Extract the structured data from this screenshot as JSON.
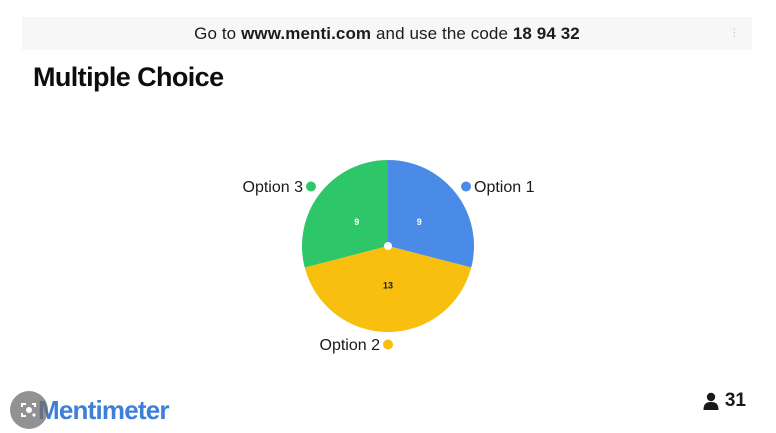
{
  "banner": {
    "prefix": "Go to",
    "url": "www.menti.com",
    "middle": "and use the code",
    "code": "18 94 32"
  },
  "question_title": "Multiple Choice",
  "chart_data": {
    "type": "pie",
    "categories": [
      "Option 1",
      "Option 2",
      "Option 3"
    ],
    "values": [
      9,
      13,
      9
    ],
    "colors": [
      "#4a8be8",
      "#f8bf0f",
      "#2dc76a"
    ],
    "legend_placement": "labels beside slices"
  },
  "footer": {
    "brand": "Mentimeter",
    "participant_count": "31",
    "participant_icon": "person-icon",
    "lens_icon": "google-lens-icon"
  }
}
